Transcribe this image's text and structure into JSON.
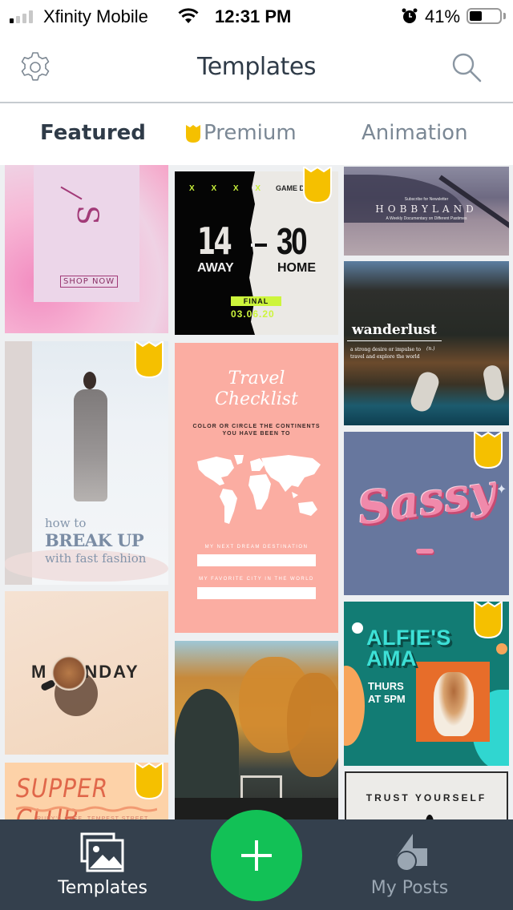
{
  "status_bar": {
    "carrier": "Xfinity Mobile",
    "time": "12:31 PM",
    "battery_percent": "41%",
    "signal_bars_active": 1,
    "signal_bars_total": 4
  },
  "nav": {
    "title": "Templates",
    "left_icon": "gear-icon",
    "right_icon": "search-icon"
  },
  "tabs": [
    {
      "label": "Featured",
      "active": true
    },
    {
      "label": "Premium",
      "active": false,
      "icon": "premium-crown-icon"
    },
    {
      "label": "Animation",
      "active": false
    }
  ],
  "colors": {
    "premium_badge": "#f5c000",
    "fab": "#12c156",
    "bottom_bar": "#34404d",
    "active_tab_text": "#2f3b48",
    "inactive_tab_text": "#7b8895"
  },
  "templates": {
    "sale": {
      "letter": "S",
      "cta": "SHOP NOW",
      "premium": false
    },
    "game_day": {
      "header_marks": "X X X X",
      "header_label": "GAME D",
      "away_score": "14",
      "home_score": "30",
      "away_label": "AWAY",
      "home_label": "HOME",
      "status": "FINAL",
      "date": "03.06.20",
      "premium": true
    },
    "hobbyland": {
      "kicker": "Subscribe for Newsletter",
      "title": "HOBBYLAND",
      "subtitle": "A Weekly Documentary on Different Pastimes",
      "premium": false
    },
    "wanderlust": {
      "title": "wanderlust",
      "definition": "a strong desire or impulse to travel and explore the world",
      "part_of_speech": "(n.)",
      "premium": false
    },
    "fashion": {
      "line1": "how to",
      "line2": "BREAK UP",
      "line3": "with fast fashion",
      "premium": true
    },
    "travel": {
      "title_line1": "Travel",
      "title_line2": "Checklist",
      "subtitle_line1": "COLOR OR CIRCLE THE CONTINENTS",
      "subtitle_line2": "YOU HAVE BEEN TO",
      "field1_label": "MY NEXT DREAM DESTINATION",
      "field2_label": "MY FAVORITE CITY IN THE WORLD",
      "premium": false
    },
    "sassy": {
      "title": "Sassy",
      "premium": true
    },
    "monday": {
      "text_before": "M",
      "text_after": "NDAY",
      "premium": false
    },
    "supper": {
      "title": "SUPPER CLUB",
      "subtitle": "RUBY'S CAFE, TEMPEST STREET",
      "premium": true
    },
    "wedding": {
      "premium": false
    },
    "alfie": {
      "title_line1": "ALFIE'S",
      "title_line2": "AMA",
      "when_line1": "THURS",
      "when_line2": "AT 5PM",
      "premium": true
    },
    "trust": {
      "title": "TRUST YOURSELF",
      "premium": false
    }
  },
  "bottom_nav": {
    "templates_label": "Templates",
    "create_label": "+",
    "posts_label": "My Posts",
    "active": "Templates"
  }
}
